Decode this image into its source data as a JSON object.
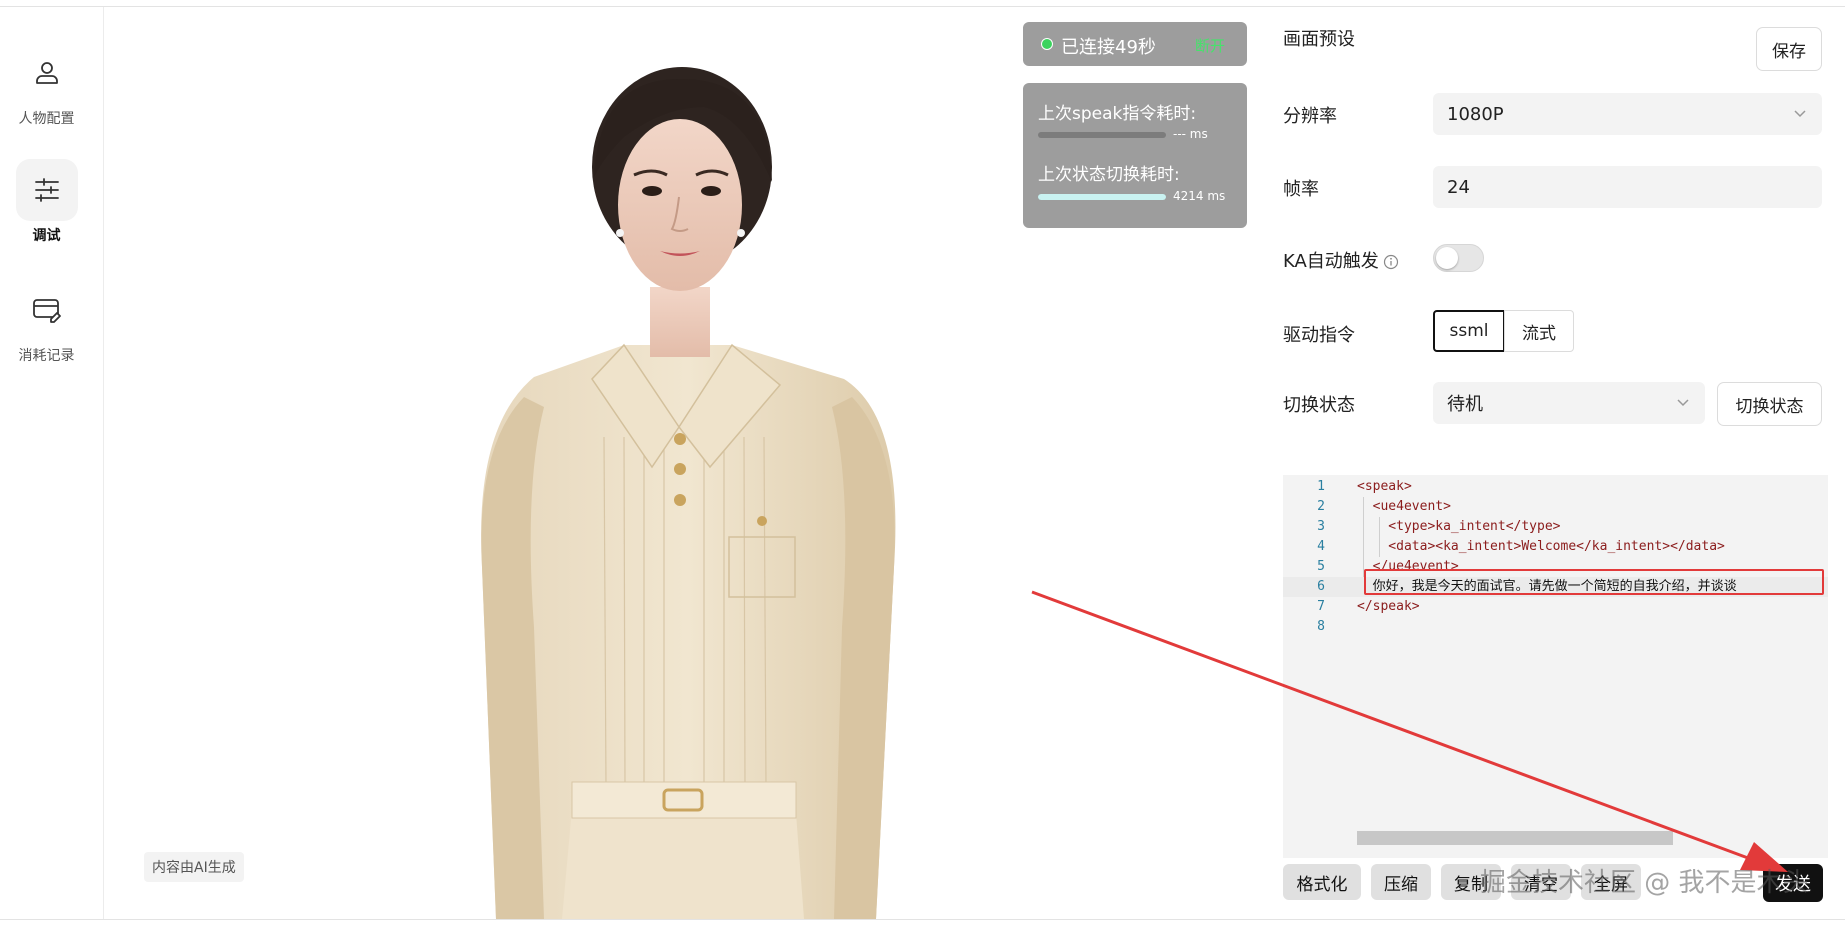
{
  "sidebar": {
    "items": [
      {
        "label": "人物配置",
        "icon": "user-icon"
      },
      {
        "label": "调试",
        "icon": "sliders-icon",
        "active": true
      },
      {
        "label": "消耗记录",
        "icon": "card-edit-icon"
      }
    ]
  },
  "stage": {
    "ai_tag": "内容由AI生成"
  },
  "status": {
    "connection_text": "已连接49秒",
    "connection_badge": "断开",
    "speak_label": "上次speak指令耗时:",
    "speak_value": "--- ms",
    "speak_fill": 0,
    "switch_label": "上次状态切换耗时:",
    "switch_value": "4214 ms",
    "switch_fill": 1.0
  },
  "panel": {
    "preset_title": "画面预设",
    "save_label": "保存",
    "resolution_label": "分辨率",
    "resolution_value": "1080P",
    "framerate_label": "帧率",
    "framerate_value": "24",
    "ka_label": "KA自动触发",
    "ka_enabled": false,
    "drive_label": "驱动指令",
    "drive_options": [
      "ssml",
      "流式"
    ],
    "drive_selected": "ssml",
    "state_label": "切换状态",
    "state_value": "待机",
    "switch_button": "切换状态"
  },
  "editor": {
    "lines": [
      {
        "n": "1",
        "text": "<speak>"
      },
      {
        "n": "2",
        "text": "  <ue4event>"
      },
      {
        "n": "3",
        "text": "    <type>ka_intent</type>"
      },
      {
        "n": "4",
        "text": "    <data><ka_intent>Welcome</ka_intent></data>"
      },
      {
        "n": "5",
        "text": "  </ue4event>"
      },
      {
        "n": "6",
        "text": "  你好，我是今天的面试官。请先做一个简短的自我介绍，并谈谈"
      },
      {
        "n": "7",
        "text": "</speak>"
      },
      {
        "n": "8",
        "text": ""
      }
    ],
    "buttons": [
      "格式化",
      "压缩",
      "复制",
      "清空",
      "全屏"
    ],
    "send_label": "发送"
  },
  "watermark": "掘金技术社区 @ 我不是木头",
  "colors": {
    "accent": "#111111",
    "connected": "#3bd35e",
    "annotation": "#e23a3a"
  }
}
